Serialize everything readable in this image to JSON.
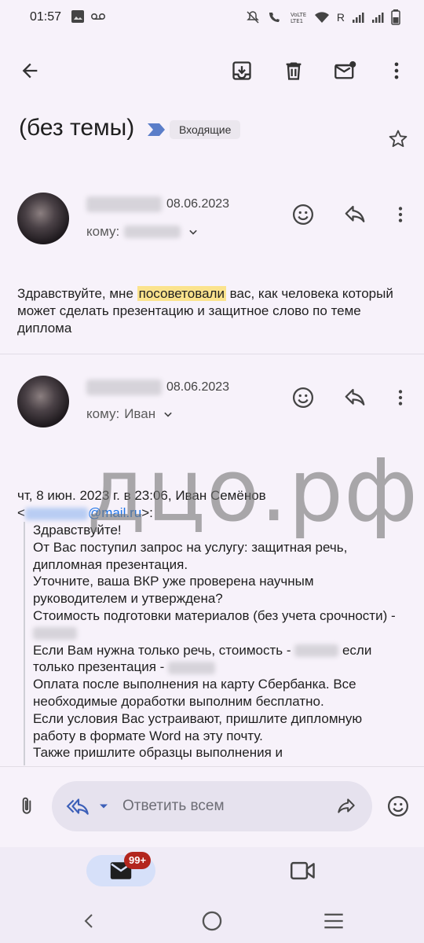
{
  "status_bar": {
    "time": "01:57",
    "network_label": "R"
  },
  "toolbar": {
    "back_icon": "arrow-back-icon",
    "archive_icon": "archive-icon",
    "delete_icon": "trash-icon",
    "mark_unread_icon": "mark-unread-icon",
    "more_icon": "more-vert-icon"
  },
  "header": {
    "subject": "(без темы)",
    "label": "Входящие"
  },
  "messages": [
    {
      "date": "08.06.2023",
      "to_prefix": "кому:",
      "to_name": "",
      "body_before": "Здравствуйте, мне ",
      "body_highlight": "посоветовали",
      "body_after": " вас, как человека который может сделать презентацию и защитное слово по теме диплома"
    },
    {
      "date": "08.06.2023",
      "to_prefix": "кому:",
      "to_name": "Иван",
      "quote_header": "чт, 8 июн. 2023 г. в 23:06, Иван Семёнов",
      "quote_email_open": "<",
      "quote_email_domain": "@mail.ru",
      "quote_email_close": ">:",
      "quote_lines": {
        "l1": "Здравствуйте!",
        "l2": "От Вас поступил запрос на услугу: защитная речь, дипломная презентация.",
        "l3": "Уточните, ваша ВКР уже проверена научным руководителем и утверждена?",
        "l4": "Стоимость подготовки материалов (без учета срочности) -",
        "l5a": "Если Вам нужна только речь, стоимость -",
        "l5b": "если только презентация -",
        "l6": "Оплата после выполнения на карту Сбербанка. Все необходимые доработки выполним бесплатно.",
        "l7": "Если условия Вас устраивают, пришлите дипломную работу в формате Word на эту почту.",
        "l8": "Также пришлите образцы выполнения и"
      }
    }
  ],
  "watermark": "дцо.рф",
  "reply_bar": {
    "placeholder": "Ответить всем"
  },
  "bottom_nav": {
    "mail_badge": "99+"
  }
}
